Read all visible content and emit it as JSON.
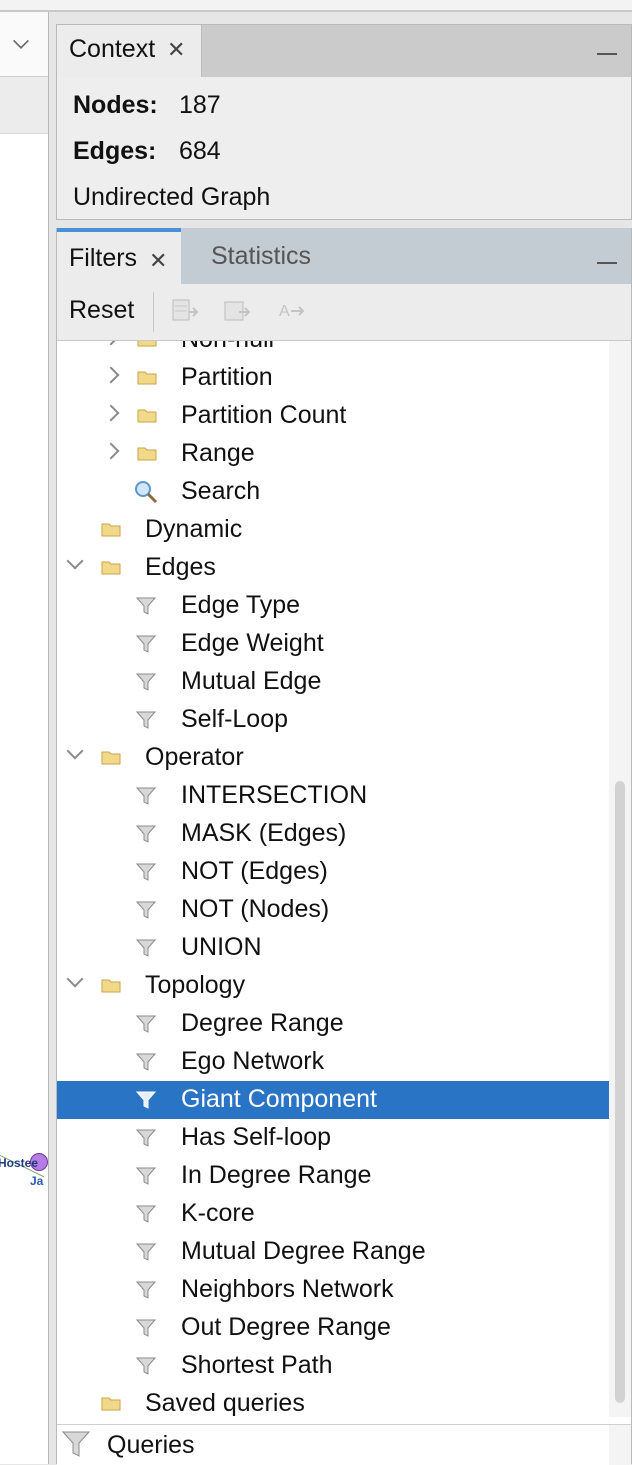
{
  "context_panel": {
    "tab_label": "Context",
    "nodes_label": "Nodes:",
    "nodes_value": "187",
    "edges_label": "Edges:",
    "edges_value": "684",
    "graph_type": "Undirected Graph"
  },
  "graph_view": {
    "node_label": "Hostee",
    "node_sublabel": "Ja"
  },
  "filters_panel": {
    "tabs": [
      {
        "label": "Filters",
        "active": true
      },
      {
        "label": "Statistics",
        "active": false
      }
    ],
    "toolbar": {
      "reset_label": "Reset"
    },
    "tree": {
      "partial_top_label": "Non-null",
      "attribute_items": [
        {
          "label": "Partition",
          "icon": "folder-icon"
        },
        {
          "label": "Partition Count",
          "icon": "folder-icon"
        },
        {
          "label": "Range",
          "icon": "folder-icon"
        },
        {
          "label": "Search",
          "icon": "search-icon"
        }
      ],
      "dynamic": {
        "label": "Dynamic"
      },
      "edges": {
        "label": "Edges",
        "items": [
          "Edge Type",
          "Edge Weight",
          "Mutual Edge",
          "Self-Loop"
        ]
      },
      "operator": {
        "label": "Operator",
        "items": [
          "INTERSECTION",
          "MASK (Edges)",
          "NOT (Edges)",
          "NOT (Nodes)",
          "UNION"
        ]
      },
      "topology": {
        "label": "Topology",
        "items": [
          "Degree Range",
          "Ego Network",
          "Giant Component",
          "Has Self-loop",
          "In Degree Range",
          "K-core",
          "Mutual Degree Range",
          "Neighbors Network",
          "Out Degree Range",
          "Shortest Path"
        ],
        "selected": "Giant Component"
      },
      "saved_queries": {
        "label": "Saved queries"
      }
    },
    "queries_label": "Queries"
  },
  "colors": {
    "selection": "#2a74c5",
    "active_tab_accent": "#4a90d6",
    "folder": "#e8c86a"
  }
}
